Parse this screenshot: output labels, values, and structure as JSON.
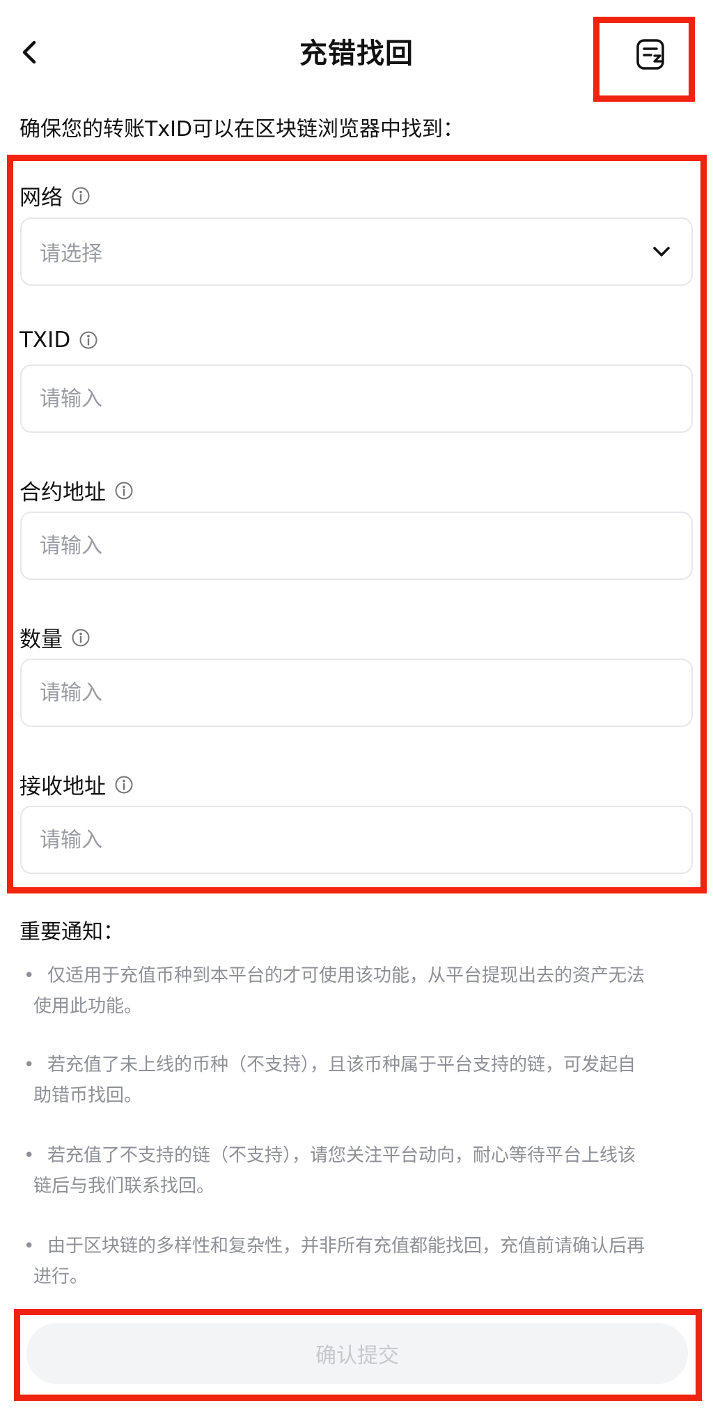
{
  "header": {
    "title": "充错找回",
    "back_icon": "chevron-left-icon",
    "history_icon": "record-list-icon"
  },
  "intro": {
    "text": "确保您的转账TxID可以在区块链浏览器中找到："
  },
  "form": {
    "network": {
      "label": "网络",
      "value": "请选择"
    },
    "txid": {
      "label": "TXID",
      "placeholder": "请输入"
    },
    "contract": {
      "label": "合约地址",
      "placeholder": "请输入"
    },
    "amount": {
      "label": "数量",
      "placeholder": "请输入"
    },
    "receiver": {
      "label": "接收地址",
      "placeholder": "请输入"
    }
  },
  "notice": {
    "title": "重要通知：",
    "items": [
      {
        "line1": "仅适用于充值币种到本平台的才可使用该功能，从平台提现出去的资产无法",
        "line2": "使用此功能。"
      },
      {
        "line1": "若充值了未上线的币种（不支持），且该币种属于平台支持的链，可发起自",
        "line2": "助错币找回。"
      },
      {
        "line1": "若充值了不支持的链（不支持），请您关注平台动向，耐心等待平台上线该",
        "line2": "链后与我们联系找回。"
      },
      {
        "line1": "由于区块链的多样性和复杂性，并非所有充值都能找回，充值前请确认后再",
        "line2": "进行。"
      }
    ]
  },
  "footer": {
    "submit_label": "确认提交"
  },
  "colors": {
    "highlight": "#f0230f",
    "placeholder": "#9a9ca3",
    "notice_text": "#8e9097",
    "button_bg": "#f3f4f6",
    "button_text": "#c6c8cd"
  }
}
